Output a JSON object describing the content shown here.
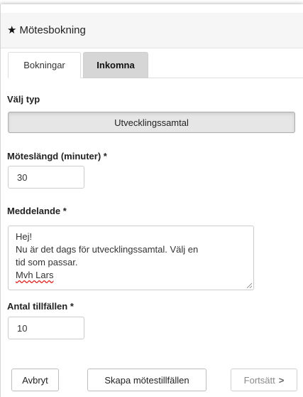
{
  "header": {
    "icon": "star-icon",
    "title": "Mötesbokning"
  },
  "tabs": [
    {
      "label": "Bokningar",
      "active": true
    },
    {
      "label": "Inkomna",
      "active": false
    }
  ],
  "form": {
    "type_label": "Välj typ",
    "type_value": "Utvecklingssamtal",
    "length_label": "Möteslängd (minuter) *",
    "length_value": "30",
    "message_label": "Meddelande *",
    "message_lines": [
      "Hej!",
      "Nu är det dags för utvecklingssamtal. Välj en",
      "tid som passar.",
      "Mvh Lars"
    ],
    "count_label": "Antal tillfällen *",
    "count_value": "10"
  },
  "buttons": {
    "cancel": "Avbryt",
    "create": "Skapa mötestillfällen",
    "continue": "Fortsätt",
    "continue_icon": "chevron-right-icon"
  },
  "colors": {
    "inactive_tab_bg": "#d6d6d6",
    "selected_type_bg": "#e6e6e6"
  }
}
